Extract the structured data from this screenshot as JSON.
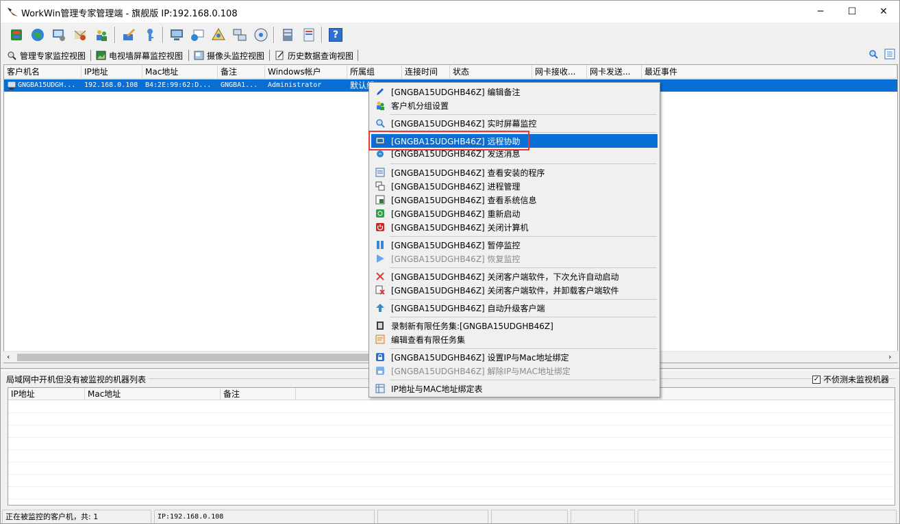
{
  "window": {
    "title": "WorkWin管理专家管理端 - 旗舰版 IP:192.168.0.108",
    "minimize_glyph": "─",
    "maximize_glyph": "☐",
    "close_glyph": "✕"
  },
  "toolbar": {
    "icons": [
      "cube-icon",
      "globe-icon",
      "monitor-gear-icon",
      "mail-icon",
      "users-icon",
      "edit-tool-icon",
      "key-icon",
      "screen-icon",
      "message-icon",
      "document-icon",
      "network-icon",
      "disk-icon",
      "server-icon",
      "report-icon",
      "help-icon"
    ],
    "help_glyph": "?"
  },
  "tabs": [
    {
      "label": "管理专家监控视图",
      "icon": "search-magnifier-icon"
    },
    {
      "label": "电视墙屏幕监控视图",
      "icon": "picture-icon"
    },
    {
      "label": "摄像头监控视图",
      "icon": "camera-icon"
    },
    {
      "label": "历史数据查询视图",
      "icon": "notepad-icon"
    }
  ],
  "main_table": {
    "columns": [
      "客户机名",
      "IP地址",
      "Mac地址",
      "备注",
      "Windows帐户",
      "所属组",
      "连接时间",
      "状态",
      "网卡接收...",
      "网卡发送...",
      "最近事件"
    ],
    "rows": [
      [
        "GNGBA15UDGH...",
        "192.168.0.108",
        "B4:2E:99:62:D...",
        "GNGBA1...",
        "Administrator",
        "默认组",
        "",
        "",
        "",
        "",
        ""
      ]
    ]
  },
  "context_menu": {
    "items": [
      {
        "label": "[GNGBA15UDGHB46Z] 编辑备注",
        "icon": "pencil-icon",
        "color": "#1d5fc9"
      },
      {
        "label": "客户机分组设置",
        "icon": "group-icon",
        "color": "#2a9a3a"
      },
      {
        "label": "[GNGBA15UDGHB46Z] 实时屏幕监控",
        "icon": "magnifier-icon",
        "color": "#3d7cc9"
      },
      {
        "label": "[GNGBA15UDGHB46Z] 远程协助",
        "icon": "remote-screen-icon",
        "color": "#2f6fa8"
      },
      {
        "label": "[GNGBA15UDGHB46Z] 发送消息",
        "icon": "send-message-icon",
        "color": "#2f8ad0"
      },
      {
        "label": "[GNGBA15UDGHB46Z] 查看安装的程序",
        "icon": "programs-icon",
        "color": "#3f6fb0"
      },
      {
        "label": "[GNGBA15UDGHB46Z] 进程管理",
        "icon": "process-icon",
        "color": "#4a4a4a"
      },
      {
        "label": "[GNGBA15UDGHB46Z] 查看系统信息",
        "icon": "system-info-icon",
        "color": "#3a7a3a"
      },
      {
        "label": "[GNGBA15UDGHB46Z] 重新启动",
        "icon": "restart-icon",
        "color": "#2ea043"
      },
      {
        "label": "[GNGBA15UDGHB46Z] 关闭计算机",
        "icon": "power-icon",
        "color": "#d32020"
      },
      {
        "label": "[GNGBA15UDGHB46Z] 暂停监控",
        "icon": "pause-icon",
        "color": "#3b84d6"
      },
      {
        "label": "[GNGBA15UDGHB46Z] 恢复监控",
        "icon": "play-icon",
        "color": "#69a7e8"
      },
      {
        "label": "[GNGBA15UDGHB46Z] 关闭客户端软件，下次允许自动启动",
        "icon": "close-x-icon",
        "color": "#d93a3a"
      },
      {
        "label": "[GNGBA15UDGHB46Z] 关闭客户端软件，并卸载客户端软件",
        "icon": "uninstall-icon",
        "color": "#d93a3a"
      },
      {
        "label": "[GNGBA15UDGHB46Z] 自动升级客户端",
        "icon": "upgrade-icon",
        "color": "#2f8ad0"
      },
      {
        "label": "录制新有限任务集:[GNGBA15UDGHB46Z]",
        "icon": "film-icon",
        "color": "#3a3a3a"
      },
      {
        "label": "编辑查看有限任务集",
        "icon": "task-list-icon",
        "color": "#c87a2a"
      },
      {
        "label": "[GNGBA15UDGHB46Z] 设置IP与Mac地址绑定",
        "icon": "lock-icon",
        "color": "#2f6fcc"
      },
      {
        "label": "[GNGBA15UDGHB46Z] 解除IP与MAC地址绑定",
        "icon": "unlock-icon",
        "color": "#7fb0e8"
      },
      {
        "label": "IP地址与MAC地址绑定表",
        "icon": "binding-table-icon",
        "color": "#4a6fa0"
      }
    ]
  },
  "bottom_panel": {
    "title": "局域网中开机但没有被监视的机器列表",
    "checkbox_label": "不侦测未监视机器",
    "checkbox_checked": true,
    "check_glyph": "✓",
    "columns": [
      "IP地址",
      "Mac地址",
      "备注"
    ]
  },
  "statusbar": {
    "clients": "正在被监控的客户机，共: 1",
    "ip": "IP:192.168.0.108"
  },
  "colors": {
    "selection": "#0a6fd4",
    "highlight_box": "#e53939"
  }
}
